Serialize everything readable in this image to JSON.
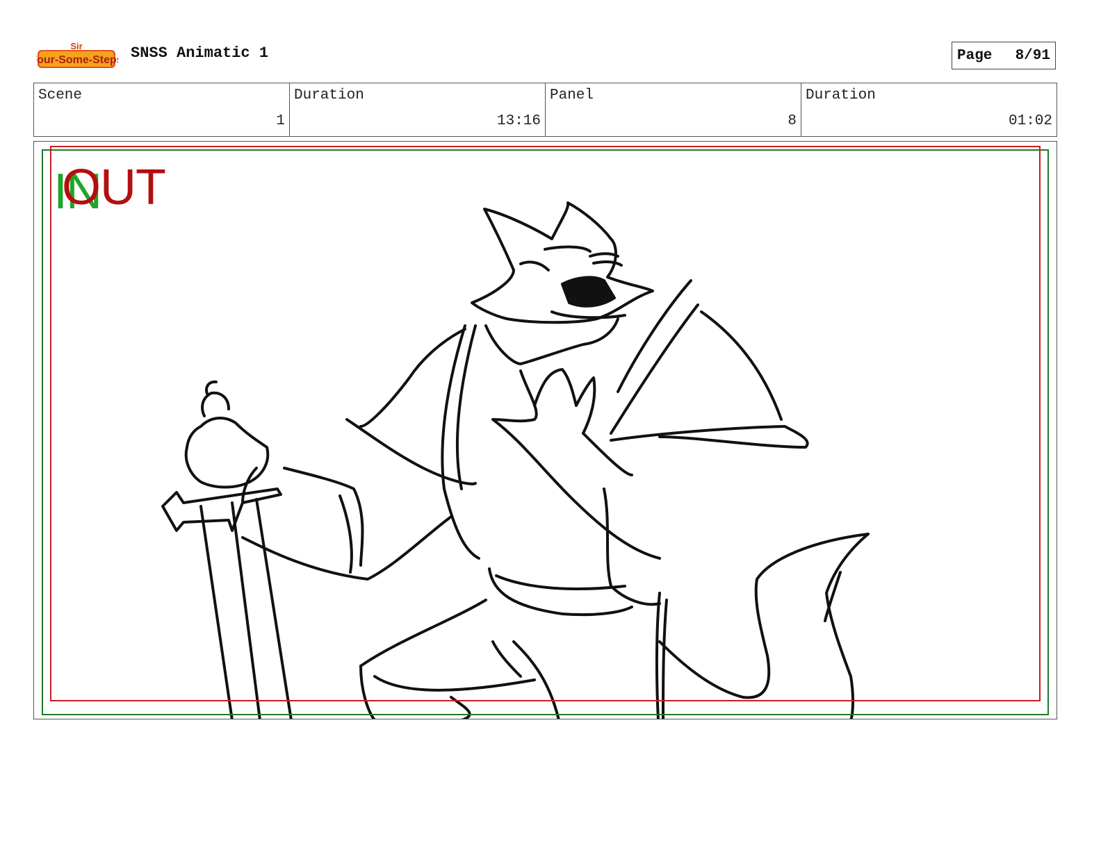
{
  "header": {
    "logo_alt": "Sir Four-Some-Steps",
    "title": "SNSS Animatic 1",
    "page_label": "Page",
    "page_number": "8/91"
  },
  "info": {
    "scene_label": "Scene",
    "scene_value": "1",
    "scene_duration_label": "Duration",
    "scene_duration_value": "13:16",
    "panel_label": "Panel",
    "panel_value": "8",
    "panel_duration_label": "Duration",
    "panel_duration_value": "01:02"
  },
  "panel": {
    "in_marker": "IN",
    "out_marker": "OUT",
    "colors": {
      "safe_frame": "#1e7a2a",
      "action_frame": "#c81e1e",
      "in": "#1fa52a",
      "out": "#b40f0f"
    }
  }
}
